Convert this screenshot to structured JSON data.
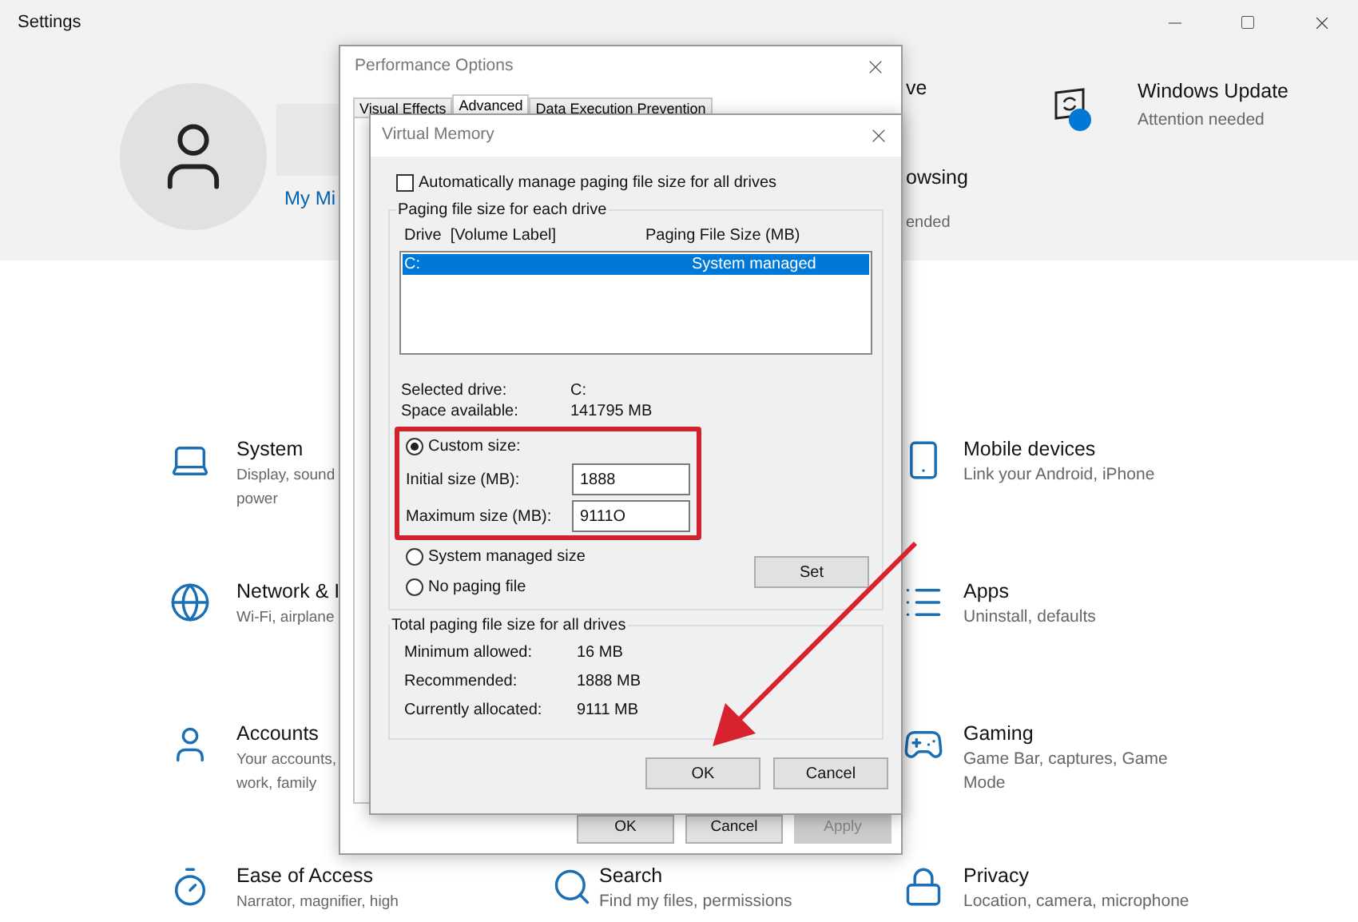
{
  "window": {
    "title": "Settings"
  },
  "header": {
    "account_link": "My Mi",
    "covered_items": [
      {
        "title": "ve"
      },
      {
        "title": "owsing",
        "subtitle": "ended"
      }
    ],
    "update": {
      "title": "Windows Update",
      "subtitle": "Attention needed"
    }
  },
  "columns": [
    {
      "items": [
        {
          "kind": "system",
          "title": "System",
          "subtitle_lines": [
            "Display, sound",
            "power"
          ]
        },
        {
          "kind": "network",
          "title": "Network & I",
          "subtitle_lines": [
            "Wi-Fi, airplane"
          ]
        },
        {
          "kind": "accounts",
          "title": "Accounts",
          "subtitle_lines": [
            "Your accounts,",
            "work, family"
          ]
        },
        {
          "kind": "ease",
          "title": "Ease of Access",
          "subtitle_lines": [
            "Narrator, magnifier, high"
          ]
        }
      ]
    },
    {
      "items": [
        {
          "kind": "search",
          "title": "Search",
          "subtitle_lines": [
            "Find my files, permissions"
          ]
        }
      ]
    },
    {
      "items": [
        {
          "kind": "mobile",
          "title": "Mobile devices",
          "subtitle_lines": [
            "Link your Android, iPhone"
          ]
        },
        {
          "kind": "apps",
          "title": "Apps",
          "subtitle_lines": [
            "Uninstall, defaults"
          ]
        },
        {
          "kind": "gaming",
          "title": "Gaming",
          "subtitle_lines": [
            "Game Bar, captures, Game",
            "Mode"
          ]
        },
        {
          "kind": "privacy",
          "title": "Privacy",
          "subtitle_lines": [
            "Location, camera, microphone"
          ]
        }
      ]
    }
  ],
  "performance_dialog": {
    "title": "Performance Options",
    "tabs": [
      {
        "label": "Visual Effects",
        "selected": false
      },
      {
        "label": "Advanced",
        "selected": true
      },
      {
        "label": "Data Execution Prevention",
        "selected": false
      }
    ],
    "buttons": [
      {
        "label": "OK",
        "disabled": false
      },
      {
        "label": "Cancel",
        "disabled": false
      },
      {
        "label": "Apply",
        "disabled": true
      }
    ]
  },
  "virtual_memory_dialog": {
    "title": "Virtual Memory",
    "auto_manage": {
      "label": "Automatically manage paging file size for all drives",
      "checked": false
    },
    "drives_group": {
      "legend": "Paging file size for each drive",
      "columns": [
        "Drive  [Volume Label]",
        "Paging File Size (MB)"
      ],
      "rows": [
        {
          "drive": "C:",
          "size": "System managed",
          "selected": true
        }
      ],
      "info": [
        {
          "label": "Selected drive:",
          "value": "C:"
        },
        {
          "label": "Space available:",
          "value": "141795 MB"
        }
      ],
      "custom_size": {
        "label": "Custom size:",
        "selected": true
      },
      "fields": [
        {
          "label": "Initial size (MB):",
          "value": "1888"
        },
        {
          "label": "Maximum size (MB):",
          "value": "9111O"
        }
      ],
      "options": [
        {
          "label": "System managed size",
          "selected": false
        },
        {
          "label": "No paging file",
          "selected": false
        }
      ],
      "set_button": "Set"
    },
    "totals_group": {
      "legend": "Total paging file size for all drives",
      "rows": [
        {
          "label": "Minimum allowed:",
          "value": "16 MB"
        },
        {
          "label": "Recommended:",
          "value": "1888 MB"
        },
        {
          "label": "Currently allocated:",
          "value": "9111 MB"
        }
      ]
    },
    "buttons": [
      {
        "label": "OK"
      },
      {
        "label": "Cancel"
      }
    ]
  }
}
